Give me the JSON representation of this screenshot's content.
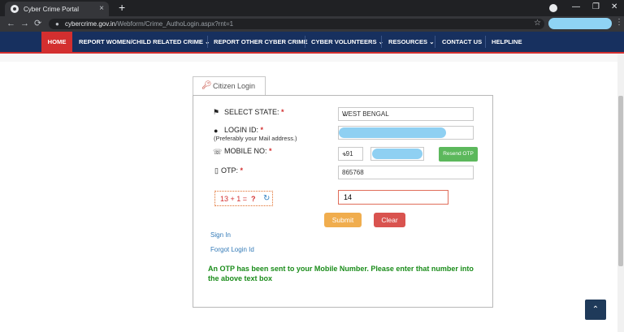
{
  "browser": {
    "tab_title": "Cyber Crime Portal",
    "tab_close": "×",
    "new_tab": "+",
    "url_domain": "cybercrime.gov.in",
    "url_path": "/Webform/Crime_AuthoLogin.aspx?rnt=1",
    "back": "←",
    "forward": "→",
    "reload": "⟳",
    "lock": "🔒",
    "star": "☆",
    "menu": "⋮",
    "win_min": "—",
    "win_max": "❐",
    "win_close": "✕"
  },
  "nav": {
    "home": "HOME",
    "report_women": "REPORT WOMEN/CHILD RELATED CRIME ⌄",
    "report_other": "REPORT OTHER CYBER CRIME",
    "volunteers": "CYBER VOLUNTEERS ⌄",
    "resources": "RESOURCES ⌄",
    "contact": "CONTACT US",
    "helpline": "HELPLINE"
  },
  "login": {
    "tab_label": "Citizen Login",
    "state_label": "SELECT STATE:",
    "state_value": "WEST BENGAL",
    "login_id_label": "LOGIN ID:",
    "login_id_hint": "(Preferably your Mail address.)",
    "mobile_label": "MOBILE NO:",
    "country_code": "+91",
    "resend_otp": "Resend OTP",
    "otp_label": "OTP:",
    "otp_value": "865768",
    "required_mark": "*",
    "captcha_expr": "13 + 1 =",
    "captcha_q": "?",
    "captcha_answer": "14",
    "submit": "Submit",
    "clear": "Clear",
    "sign_in": "Sign In",
    "forgot": "Forgot Login Id",
    "otp_message": "An OTP has been sent to your Mobile Number. Please enter that number into the above text box"
  },
  "colors": {
    "nav_bg": "#17305f",
    "active_red": "#d32f2f",
    "submit": "#f0ad4e",
    "clear": "#d9534f",
    "resend": "#5cb85c",
    "message_green": "#1a8c1a"
  }
}
